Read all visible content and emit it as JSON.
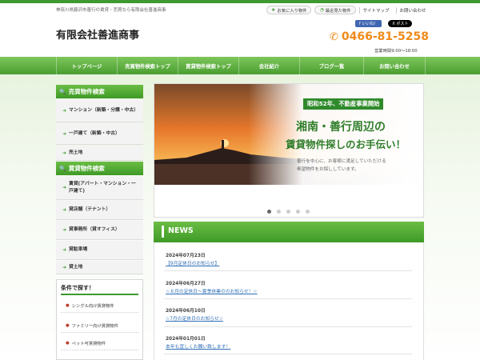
{
  "header": {
    "tagline": "神奈川県藤沢市善行の賃貸・売買なら有限会社善進商事",
    "site_name": "有限会社善進商事",
    "top_links": {
      "favorites": "お気に入り物件",
      "recent": "最近見た物件",
      "sitemap": "サイトマップ",
      "contact": "お問い合わせ"
    },
    "social": {
      "like": "いいね！",
      "post": "ポスト"
    },
    "phone": "0466-81-5258",
    "hours": "営業時間9:00～18:00"
  },
  "nav": {
    "items": [
      {
        "label": "トップページ"
      },
      {
        "label": "売買物件検索トップ"
      },
      {
        "label": "賃貸物件検索トップ"
      },
      {
        "label": "会社紹介"
      },
      {
        "label": "ブログ一覧"
      },
      {
        "label": "お問い合わせ"
      }
    ]
  },
  "sidebar": {
    "sale_title": "売買物件検索",
    "sale_items": [
      {
        "label": "マンション（新築・分譲・中古）"
      },
      {
        "label": "一戸建て（新築・中古）"
      },
      {
        "label": "売土地"
      }
    ],
    "rent_title": "賃貸物件検索",
    "rent_items": [
      {
        "label": "賃貸(アパート・マンション・一戸建て)"
      },
      {
        "label": "貸店舗（テナント）"
      },
      {
        "label": "貸事務所（貸オフィス）"
      },
      {
        "label": "貸駐車場"
      },
      {
        "label": "貸土地"
      }
    ],
    "conditions_title": "条件で探す！",
    "conditions": [
      {
        "label": "シングル向け賃貸物件"
      },
      {
        "label": "ファミリー向け賃貸物件"
      },
      {
        "label": "ペット可賃貸物件"
      }
    ]
  },
  "slider": {
    "badge": "昭和52年、不動産事業開始",
    "headline1": "湘南・善行周辺の",
    "headline2": "賃貸物件探しのお手伝い！",
    "sub1": "善行を中心に、お客様に満足していただける",
    "sub2": "希望物件をお探ししています。",
    "active_dot": 0,
    "dot_count": 5
  },
  "news": {
    "title": "NEWS",
    "items": [
      {
        "date": "2024年07月23日",
        "text": "【9月定休日のお知らせ】"
      },
      {
        "date": "2024年06月27日",
        "text": "☆８月の定休日～夏季休業ののお知らせ！☆"
      },
      {
        "date": "2024年06月10日",
        "text": "☆7月の定休日のお知らせ☆"
      },
      {
        "date": "2024年01月01日",
        "text": "本年も宜しくお願い致します！"
      }
    ]
  },
  "colors": {
    "brand_green": "#3d9a2e",
    "phone_orange": "#ef8a1a",
    "link_blue": "#2f6fb7"
  }
}
